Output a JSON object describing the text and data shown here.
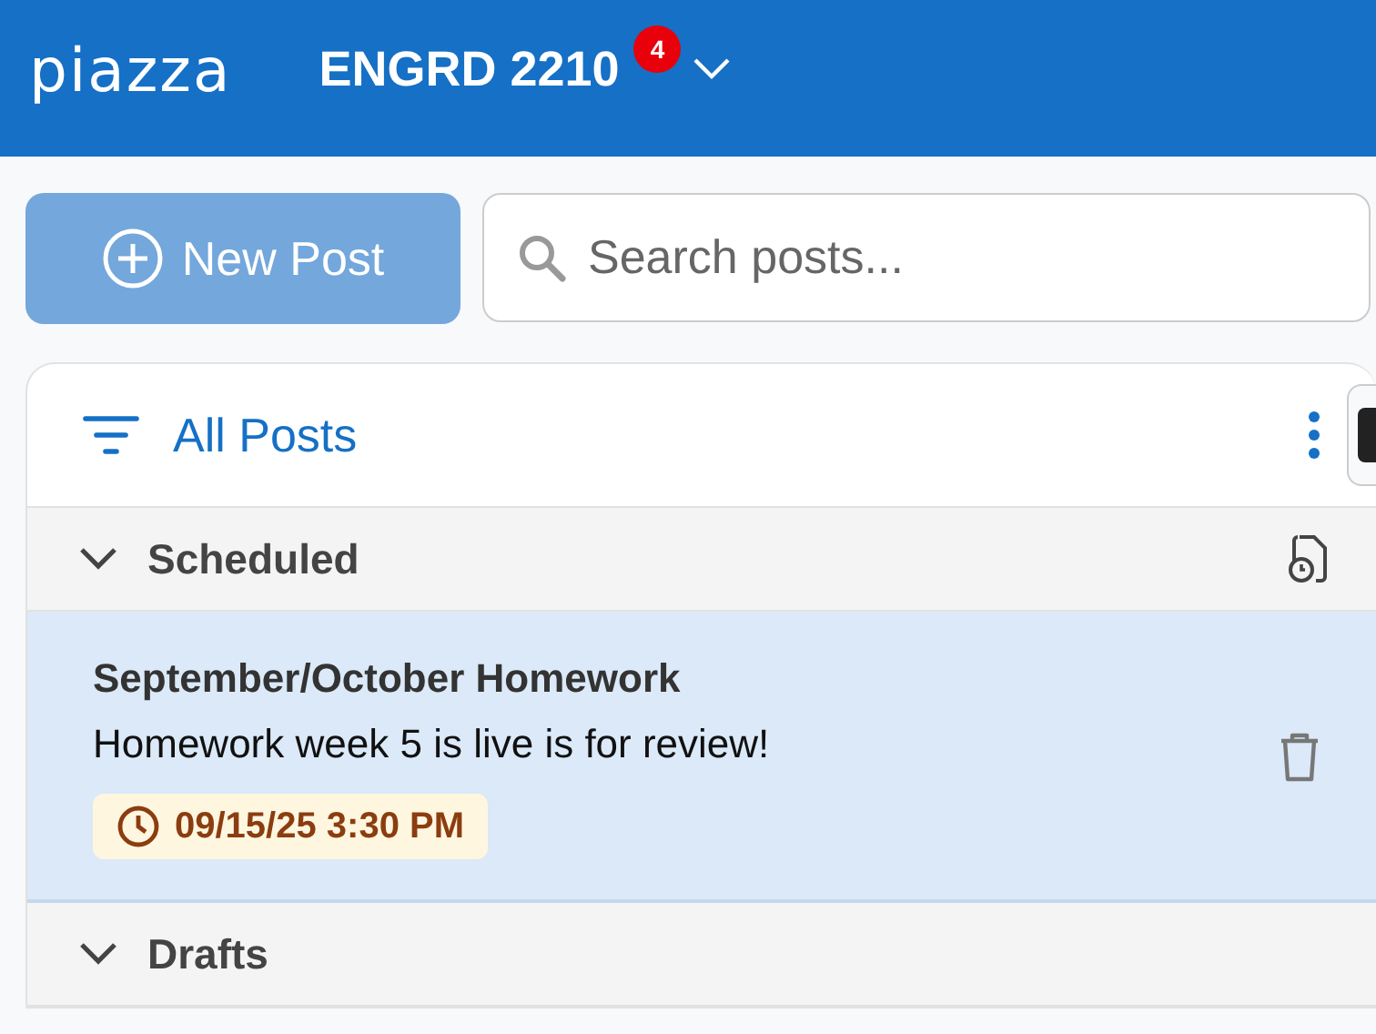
{
  "header": {
    "logo": "piazza",
    "course": "ENGRD 2210",
    "badge": "4"
  },
  "new_post_button": {
    "label": "New Post"
  },
  "search": {
    "placeholder": "Search posts..."
  },
  "filter": {
    "label": "All Posts"
  },
  "sections": [
    {
      "title": "Scheduled",
      "expanded": true,
      "posts": [
        {
          "title": "September/October Homework",
          "summary": "Homework week 5 is live is for review!",
          "scheduled": "09/15/25 3:30 PM",
          "selected": true
        }
      ]
    },
    {
      "title": "Drafts",
      "expanded": true
    }
  ]
}
